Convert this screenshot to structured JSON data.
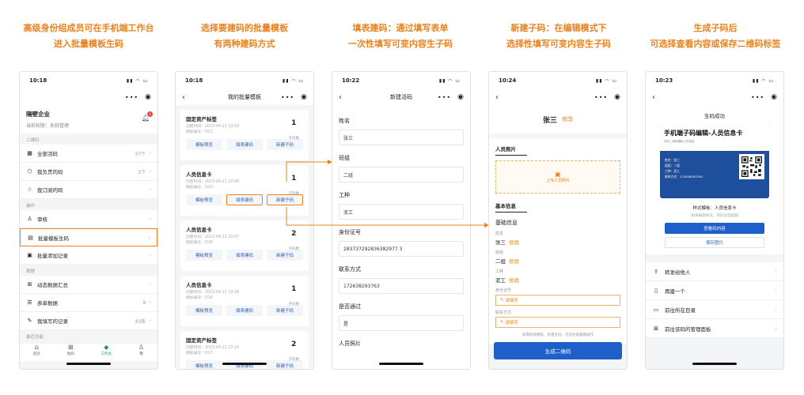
{
  "captions": [
    {
      "l1": "高级身份组成员可在手机端工作台",
      "l2": "进入批量模板生码"
    },
    {
      "l1": "选择要建码的批量模板",
      "l2": "有两种建码方式"
    },
    {
      "l1": "填表建码：通过填写表单",
      "l2": "一次性填写可变内容生子码"
    },
    {
      "l1": "新建子码：在编辑模式下",
      "l2": "选择性填写可变内容生子码"
    },
    {
      "l1": "生成子码后",
      "l2": "可选择查看内容或保存二维码标签"
    }
  ],
  "colors": {
    "accent": "#e8821e",
    "primary": "#1f5fc9"
  },
  "phone1": {
    "time": "10:18",
    "org_name": "隔壁企业",
    "permission": "当前权限：系统管理",
    "badge": "1",
    "section_qr": "二维码",
    "items_qr": [
      {
        "icon": "grid-icon",
        "glyph": "▦",
        "label": "全部活码",
        "count": "37个"
      },
      {
        "icon": "cube-icon",
        "glyph": "⬡",
        "label": "我负责的码",
        "count": "3个"
      },
      {
        "icon": "star-icon",
        "glyph": "☆",
        "label": "我订阅的码",
        "count": ""
      }
    ],
    "section_ops": "操作",
    "items_ops": [
      {
        "icon": "user-icon",
        "glyph": "♙",
        "label": "审核",
        "count": ""
      },
      {
        "icon": "batch-icon",
        "glyph": "▤",
        "label": "批量模板生码",
        "count": ""
      },
      {
        "icon": "record-icon",
        "glyph": "▣",
        "label": "批量添加记录",
        "count": ""
      }
    ],
    "section_data": "数据",
    "items_data": [
      {
        "icon": "summary-icon",
        "glyph": "⊞",
        "label": "动态数据汇总",
        "count": ""
      },
      {
        "icon": "table-icon",
        "glyph": "☰",
        "label": "表单数据",
        "count": "9"
      },
      {
        "icon": "edit-icon",
        "glyph": "✎",
        "label": "我填写的记录",
        "count": "43条"
      }
    ],
    "section_more": "最近功能",
    "tabs": [
      {
        "icon": "home-icon",
        "glyph": "⌂",
        "label": "首页"
      },
      {
        "icon": "apps-icon",
        "glyph": "⊞",
        "label": "生码"
      },
      {
        "icon": "workbench-icon",
        "glyph": "◆",
        "label": "工作台"
      },
      {
        "icon": "profile-icon",
        "glyph": "♙",
        "label": "我"
      }
    ]
  },
  "phone2": {
    "time": "10:18",
    "title": "我的批量模板",
    "cards": [
      {
        "name": "固定资产标签",
        "created": "创建时间：2023-04-21 10:03",
        "code": "模板编号：D21",
        "count": "1",
        "unit": "子码数"
      },
      {
        "name": "人员信息卡",
        "created": "创建时间：2023-04-21 10:06",
        "code": "模板编号：D20",
        "count": "1",
        "unit": "子码数"
      },
      {
        "name": "人员信息卡",
        "created": "创建时间：2023-04-21 10:07",
        "code": "模板编号：D18",
        "count": "2",
        "unit": "子码数"
      },
      {
        "name": "人员信息卡",
        "created": "创建时间：2023-04-21 10:26",
        "code": "模板编号：D16",
        "count": "1",
        "unit": "子码数"
      },
      {
        "name": "固定资产标签",
        "created": "创建时间：2023-04-21 10:20",
        "code": "模板编号：D17",
        "count": "2",
        "unit": "子码数"
      }
    ],
    "btn_preview": "模板预览",
    "btn_form": "填表建码",
    "btn_new": "新建子码"
  },
  "phone3": {
    "time": "10:22",
    "title": "新建活码",
    "fields": [
      {
        "label": "姓名",
        "value": "张三"
      },
      {
        "label": "班组",
        "value": "二组"
      },
      {
        "label": "工种",
        "value": "泥工"
      },
      {
        "label": "身份证号",
        "value": "283737292836382977 3"
      },
      {
        "label": "联系方式",
        "value": "172638293763"
      },
      {
        "label": "是否通过",
        "value": "是"
      }
    ],
    "last_label": "人员照片"
  },
  "phone4": {
    "time": "10:24",
    "name": "张三",
    "edit": "修改",
    "sec_photo": "人员照片",
    "upload": "上传人员照片",
    "sec_basic": "基本信息",
    "basic_heading": "基础信息",
    "f1_label": "姓名",
    "f1_value": "张三",
    "f2_label": "班组",
    "f2_value": "二组",
    "f3_label": "工种",
    "f3_value": "泥工",
    "f4_label": "身份证号",
    "f4_fill": "请填写",
    "f5_label": "联系方式",
    "f5_fill": "请填写",
    "tip": "如需修改模板、批量生码，可前往电脑端操作",
    "generate": "生成二维码"
  },
  "phone5": {
    "time": "10:23",
    "status": "生码成功",
    "card_title": "手机端子码编辑-人员信息卡",
    "card_sub": "同步二维码模板人员信息",
    "card_rows": [
      "姓名：张三",
      "班组：二组",
      "工种：泥工",
      "联系方式：172638293763"
    ],
    "style_line": "样式模板：人员信息卡",
    "style_hint": "（如要编辑样式，请前往电脑端）",
    "btn_view": "查看码内容",
    "btn_save": "保存图片",
    "actions": [
      {
        "icon": "share-icon",
        "glyph": "⇪",
        "label": "转发给他人"
      },
      {
        "icon": "file-icon",
        "glyph": "▯",
        "label": "再建一个"
      },
      {
        "icon": "folder-icon",
        "glyph": "▭",
        "label": "前往所在目录"
      },
      {
        "icon": "panel-icon",
        "glyph": "⊞",
        "label": "前往该码的管理面板"
      }
    ]
  }
}
